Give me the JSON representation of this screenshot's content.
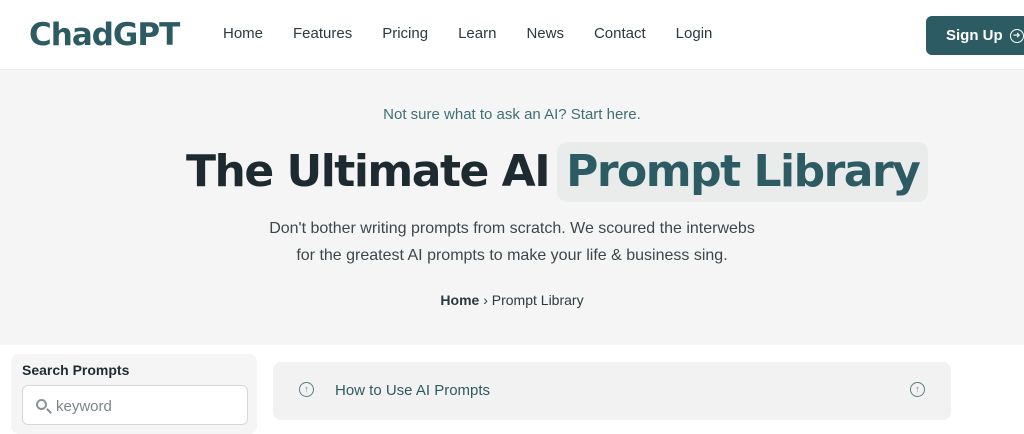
{
  "header": {
    "logo": "ChadGPT",
    "nav": [
      "Home",
      "Features",
      "Pricing",
      "Learn",
      "News",
      "Contact",
      "Login"
    ],
    "signup_label": "Sign Up",
    "brand_color": "#2d5b63"
  },
  "hero": {
    "tagline": "Not sure what to ask an AI? Start here.",
    "title_main": "The Ultimate AI",
    "title_highlight": "Prompt Library",
    "description_line1": "Don't bother writing prompts from scratch. We scoured the interwebs",
    "description_line2": "for the greatest AI prompts to make your life & business sing.",
    "breadcrumb_home": "Home",
    "breadcrumb_separator": "›",
    "breadcrumb_current": "Prompt Library"
  },
  "sidebar": {
    "search_label": "Search Prompts",
    "search_placeholder": "keyword",
    "search_value": ""
  },
  "accordion": {
    "item_label": "How to Use AI Prompts"
  }
}
